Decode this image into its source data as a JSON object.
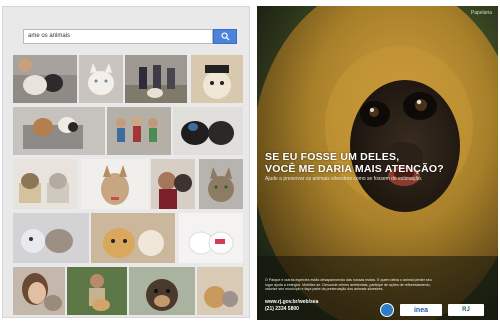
{
  "search": {
    "query": "ame os animais"
  },
  "thumbnails": [
    {
      "name": "thumb-man-with-cat"
    },
    {
      "name": "thumb-white-kitten"
    },
    {
      "name": "thumb-people-with-dogs"
    },
    {
      "name": "thumb-dog-with-hat"
    },
    {
      "name": "thumb-dogs-in-cart"
    },
    {
      "name": "thumb-children-group"
    },
    {
      "name": "thumb-black-dogs"
    },
    {
      "name": "thumb-kittens-in-cups"
    },
    {
      "name": "thumb-dog-with-bow"
    },
    {
      "name": "thumb-boy-kissing-dog"
    },
    {
      "name": "thumb-tabby-cat"
    },
    {
      "name": "thumb-cat-and-dog-toys"
    },
    {
      "name": "thumb-puppy-and-kitten"
    },
    {
      "name": "thumb-white-puppies"
    },
    {
      "name": "thumb-girl-with-cat"
    },
    {
      "name": "thumb-kid-with-puppy"
    },
    {
      "name": "thumb-dog-portrait"
    },
    {
      "name": "thumb-puppy-with-kitten"
    }
  ],
  "poster": {
    "headline_line1": "SE EU FOSSE UM DELES,",
    "headline_line2": "VOCÊ ME DARIA MAIS ATENÇÃO?",
    "subline": "Ajude a preservar os animais silvestres como se fossem de estimação.",
    "body": "O Parque e outras espécies estão desaparecendo das nossas matas. E quem deixa o animal perder seu lugar ajuda a extinguir. Mobilize-se. Denuncie crimes ambientais, participe de ações de reflorestamento, valorize seu município e faça parte da preservação dos animais silvestres.",
    "url": "www.rj.gov.br/web/sea",
    "phone": "(21) 2334 5800",
    "logo_text_1": "inea",
    "logo_text_2": "RJ",
    "corner_text": "Papelaria",
    "colors": {
      "fur": "#b38a2a",
      "face": "#2b2117",
      "background": "#3c4a23"
    }
  }
}
